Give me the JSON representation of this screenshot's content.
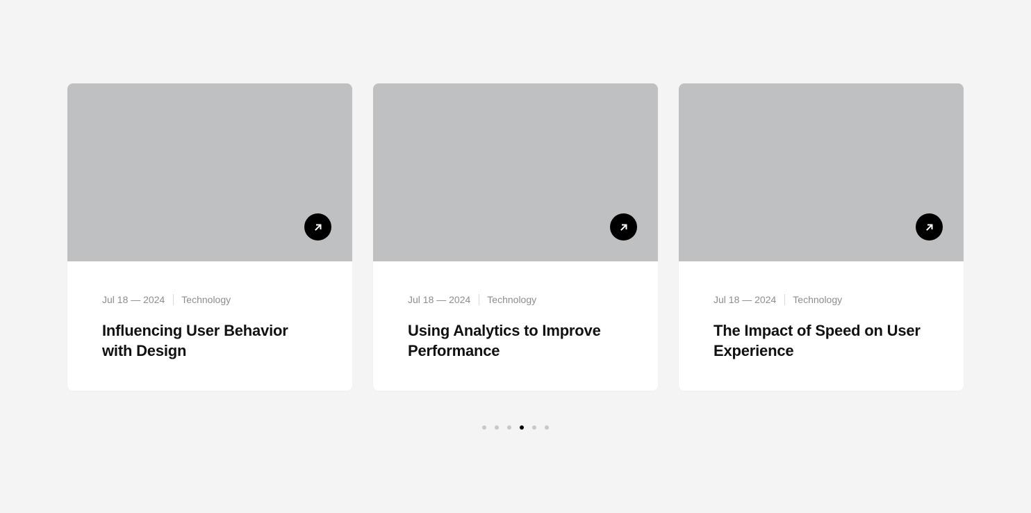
{
  "posts": [
    {
      "date": "Jul 18 — 2024",
      "category": "Technology",
      "title": "Influencing User Behavior with Design",
      "link_icon": "arrow-up-right-icon"
    },
    {
      "date": "Jul 18 — 2024",
      "category": "Technology",
      "title": "Using Analytics to Improve Performance",
      "link_icon": "arrow-up-right-icon"
    },
    {
      "date": "Jul 18 — 2024",
      "category": "Technology",
      "title": "The Impact of Speed on User Experience",
      "link_icon": "arrow-up-right-icon"
    }
  ],
  "pagination": {
    "total_dots": 6,
    "active_index": 3
  },
  "colors": {
    "background": "#f4f4f4",
    "card_background": "#ffffff",
    "image_placeholder": "#bfc0c1",
    "button_background": "#000000",
    "meta_text": "#8d8d8d",
    "title_text": "#111111",
    "dot_inactive": "#c8c8c8",
    "dot_active": "#000000"
  }
}
